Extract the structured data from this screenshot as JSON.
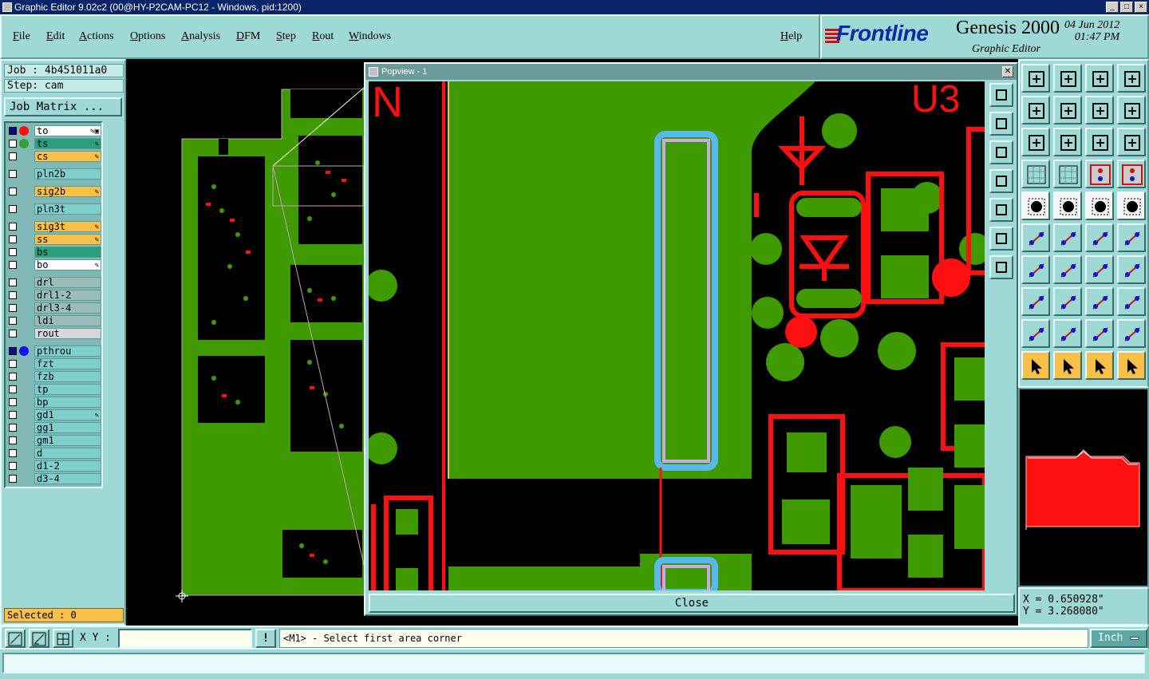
{
  "window": {
    "title": "Graphic Editor 9.02c2 (00@HY-P2CAM-PC12 - Windows, pid:1200)",
    "min": "_",
    "max": "□",
    "close": "×"
  },
  "menu": {
    "items": [
      "File",
      "Edit",
      "Actions",
      "Options",
      "Analysis",
      "DFM",
      "Step",
      "Rout",
      "Windows"
    ],
    "help": "Help"
  },
  "brand": {
    "logo": "Frontline",
    "product": "Genesis 2000",
    "subtitle": "Graphic Editor",
    "date": "04 Jun 2012",
    "time": "01:47 PM"
  },
  "left": {
    "job": "Job : 4b451011a0",
    "step": "Step: cam",
    "job_matrix": "Job Matrix ...",
    "selected": "Selected : 0"
  },
  "layers": [
    {
      "name": "to",
      "color": "#ffffff",
      "dot": "#ff1010",
      "checked": true,
      "flag": "✎▣"
    },
    {
      "name": "ts",
      "color": "#2aa07a",
      "dot": "#30a030",
      "checked": false,
      "flag": "✎"
    },
    {
      "name": "cs",
      "color": "#f8c048",
      "dot": "",
      "checked": false,
      "flag": "✎"
    },
    {
      "sep": true
    },
    {
      "name": "pln2b",
      "color": "#7fd0cc",
      "dot": "",
      "checked": false,
      "flag": ""
    },
    {
      "sep": true
    },
    {
      "name": "sig2b",
      "color": "#f8c048",
      "dot": "",
      "checked": false,
      "flag": "✎"
    },
    {
      "sep": true
    },
    {
      "name": "pln3t",
      "color": "#7fd0cc",
      "dot": "",
      "checked": false,
      "flag": ""
    },
    {
      "sep": true
    },
    {
      "name": "sig3t",
      "color": "#f8c048",
      "dot": "",
      "checked": false,
      "flag": "✎"
    },
    {
      "name": "ss",
      "color": "#f8c048",
      "dot": "",
      "checked": false,
      "flag": "✎"
    },
    {
      "name": "bs",
      "color": "#2aa07a",
      "dot": "",
      "checked": false,
      "flag": ""
    },
    {
      "name": "bo",
      "color": "#ffffff",
      "dot": "",
      "checked": false,
      "flag": "✎"
    },
    {
      "sep": true
    },
    {
      "name": "drl",
      "color": "#9bbcbb",
      "dot": "",
      "checked": false,
      "flag": ""
    },
    {
      "name": "drl1-2",
      "color": "#9bbcbb",
      "dot": "",
      "checked": false,
      "flag": ""
    },
    {
      "name": "drl3-4",
      "color": "#9bbcbb",
      "dot": "",
      "checked": false,
      "flag": ""
    },
    {
      "name": "ldi",
      "color": "#9bbcbb",
      "dot": "",
      "checked": false,
      "flag": ""
    },
    {
      "name": "rout",
      "color": "#d8d8d8",
      "dot": "",
      "checked": false,
      "flag": ""
    },
    {
      "sep": true
    },
    {
      "name": "pthrou",
      "color": "#7fd0cc",
      "dot": "#1010ff",
      "checked": true,
      "flag": ""
    },
    {
      "name": "fzt",
      "color": "#7fd0cc",
      "dot": "",
      "checked": false,
      "flag": ""
    },
    {
      "name": "fzb",
      "color": "#7fd0cc",
      "dot": "",
      "checked": false,
      "flag": ""
    },
    {
      "name": "tp",
      "color": "#7fd0cc",
      "dot": "",
      "checked": false,
      "flag": ""
    },
    {
      "name": "bp",
      "color": "#7fd0cc",
      "dot": "",
      "checked": false,
      "flag": ""
    },
    {
      "name": "gd1",
      "color": "#7fd0cc",
      "dot": "",
      "checked": false,
      "flag": "✎"
    },
    {
      "name": "gg1",
      "color": "#7fd0cc",
      "dot": "",
      "checked": false,
      "flag": ""
    },
    {
      "name": "gm1",
      "color": "#7fd0cc",
      "dot": "",
      "checked": false,
      "flag": ""
    },
    {
      "name": "d",
      "color": "#7fd0cc",
      "dot": "",
      "checked": false,
      "flag": ""
    },
    {
      "name": "d1-2",
      "color": "#7fd0cc",
      "dot": "",
      "checked": false,
      "flag": ""
    },
    {
      "name": "d3-4",
      "color": "#7fd0cc",
      "dot": "",
      "checked": false,
      "flag": ""
    }
  ],
  "popview": {
    "title": "Popview - 1",
    "close_label": "Close",
    "labels": {
      "ref_n": "N",
      "ref_u3": "U3"
    }
  },
  "coords": {
    "x": "X = 0.650928\"",
    "y": "Y = 3.268080\""
  },
  "bottom": {
    "xy_label": "X Y :",
    "xy_value": "",
    "bang": "!",
    "prompt": "<M1> - Select first area corner",
    "units": "Inch"
  },
  "colors": {
    "panel": "#9fd9d6",
    "copper_green": "#3f9a00",
    "pad_red": "#ff1010",
    "highlight_blue": "#5ab8f0"
  },
  "icons": {
    "right_toolbar": [
      "step-in-icon",
      "step-out-icon",
      "home-icon",
      "window-icon",
      "pan-left-icon",
      "pan-right-icon",
      "zoom-back-icon",
      "redraw-icon",
      "zoom-fit-icon",
      "center-icon",
      "one-to-one-icon",
      "help-icon",
      "measure-icon",
      "grid-icon",
      "layer-compare-icon",
      "layer-swap-icon",
      "select-icon",
      "net-icon",
      "ruler-icon",
      "snap-icon",
      "connect-icon",
      "cross-icon",
      "draw-line-icon",
      "add-pad-icon",
      "angle-icon",
      "slash-icon",
      "rotate-icon",
      "flip-icon",
      "pad-select-icon",
      "minus-icon",
      "resize-icon",
      "copy-icon",
      "triangle-icon",
      "triangle-a-icon",
      "triangle-b-icon",
      "triangle-c-icon",
      "pointer-icon",
      "pointer-box-icon",
      "pointer-circle-icon",
      "pointer-path-icon"
    ]
  }
}
